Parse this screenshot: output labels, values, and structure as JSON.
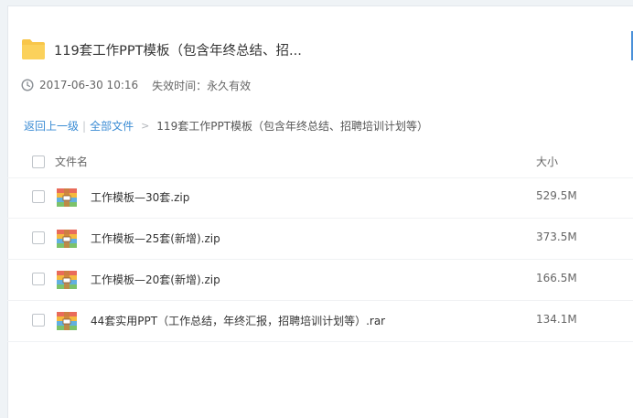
{
  "share": {
    "title": "119套工作PPT模板（包含年终总结、招...",
    "date": "2017-06-30 10:16",
    "expiry": "失效时间：永久有效"
  },
  "breadcrumb": {
    "back": "返回上一级",
    "separator": "|",
    "all_files": "全部文件",
    "arrow": ">",
    "current": "119套工作PPT模板（包含年终总结、招聘培训计划等）"
  },
  "file_list": {
    "columns": {
      "name": "文件名",
      "size": "大小"
    },
    "files": [
      {
        "name": "工作模板—30套.zip",
        "size": "529.5M"
      },
      {
        "name": "工作模板—25套(新增).zip",
        "size": "373.5M"
      },
      {
        "name": "工作模板—20套(新增).zip",
        "size": "166.5M"
      },
      {
        "name": "44套实用PPT（工作总结，年终汇报，招聘培训计划等）.rar",
        "size": "134.1M"
      }
    ]
  },
  "colors": {
    "link": "#3b8cd4",
    "folder": "#f8c64a",
    "accent": "#4a90d9"
  }
}
